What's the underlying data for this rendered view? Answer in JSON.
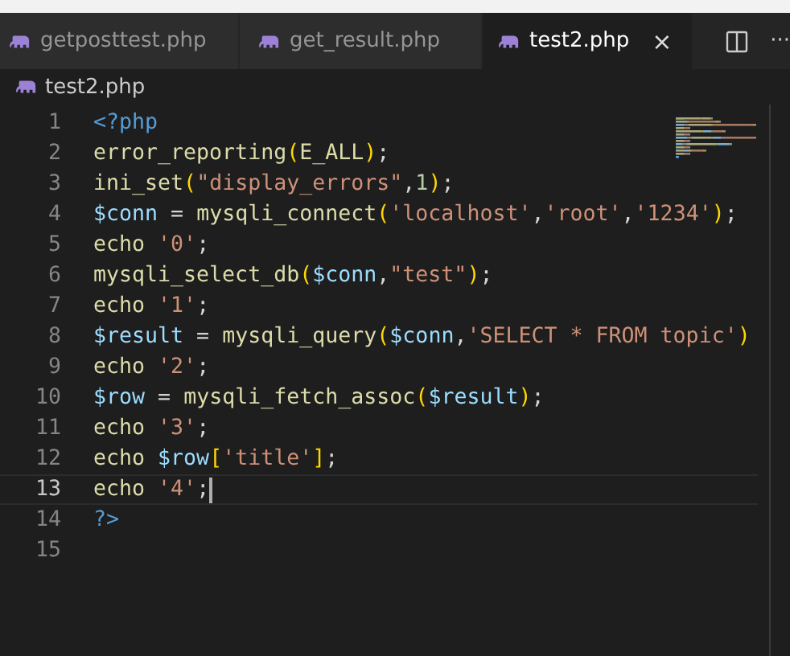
{
  "tabs": [
    {
      "label": "getposttest.php",
      "selected": false
    },
    {
      "label": "get_result.php",
      "selected": false
    },
    {
      "label": "test2.php",
      "selected": true,
      "close": "×"
    }
  ],
  "tab_actions": {
    "more": "···"
  },
  "breadcrumb": "test2.php",
  "lines": [
    {
      "number": "1",
      "current": false,
      "tokens": [
        {
          "kind": "tag",
          "text": "<?php"
        }
      ]
    },
    {
      "number": "2",
      "current": false,
      "tokens": [
        {
          "kind": "fn",
          "text": "error_reporting"
        },
        {
          "kind": "bracket",
          "text": "("
        },
        {
          "kind": "fn",
          "text": "E_ALL"
        },
        {
          "kind": "bracket",
          "text": ")"
        },
        {
          "kind": "plain",
          "text": ";"
        }
      ]
    },
    {
      "number": "3",
      "current": false,
      "tokens": [
        {
          "kind": "fn",
          "text": "ini_set"
        },
        {
          "kind": "bracket",
          "text": "("
        },
        {
          "kind": "str",
          "text": "\"display_errors\""
        },
        {
          "kind": "plain",
          "text": ","
        },
        {
          "kind": "num",
          "text": "1"
        },
        {
          "kind": "bracket",
          "text": ")"
        },
        {
          "kind": "plain",
          "text": ";"
        }
      ]
    },
    {
      "number": "4",
      "current": false,
      "tokens": [
        {
          "kind": "var",
          "text": "$conn"
        },
        {
          "kind": "plain",
          "text": " = "
        },
        {
          "kind": "fn",
          "text": "mysqli_connect"
        },
        {
          "kind": "bracket",
          "text": "("
        },
        {
          "kind": "str",
          "text": "'localhost'"
        },
        {
          "kind": "plain",
          "text": ","
        },
        {
          "kind": "str",
          "text": "'root'"
        },
        {
          "kind": "plain",
          "text": ","
        },
        {
          "kind": "str",
          "text": "'1234'"
        },
        {
          "kind": "bracket",
          "text": ")"
        },
        {
          "kind": "plain",
          "text": ";"
        }
      ]
    },
    {
      "number": "5",
      "current": false,
      "tokens": [
        {
          "kind": "fn",
          "text": "echo "
        },
        {
          "kind": "str",
          "text": "'0'"
        },
        {
          "kind": "plain",
          "text": ";"
        }
      ]
    },
    {
      "number": "6",
      "current": false,
      "tokens": [
        {
          "kind": "fn",
          "text": "mysqli_select_db"
        },
        {
          "kind": "bracket",
          "text": "("
        },
        {
          "kind": "var",
          "text": "$conn"
        },
        {
          "kind": "plain",
          "text": ","
        },
        {
          "kind": "str",
          "text": "\"test\""
        },
        {
          "kind": "bracket",
          "text": ")"
        },
        {
          "kind": "plain",
          "text": ";"
        }
      ]
    },
    {
      "number": "7",
      "current": false,
      "tokens": [
        {
          "kind": "fn",
          "text": "echo "
        },
        {
          "kind": "str",
          "text": "'1'"
        },
        {
          "kind": "plain",
          "text": ";"
        }
      ]
    },
    {
      "number": "8",
      "current": false,
      "tokens": [
        {
          "kind": "var",
          "text": "$result"
        },
        {
          "kind": "plain",
          "text": " = "
        },
        {
          "kind": "fn",
          "text": "mysqli_query"
        },
        {
          "kind": "bracket",
          "text": "("
        },
        {
          "kind": "var",
          "text": "$conn"
        },
        {
          "kind": "plain",
          "text": ","
        },
        {
          "kind": "str",
          "text": "'SELECT * FROM topic'"
        },
        {
          "kind": "bracket",
          "text": ")"
        }
      ]
    },
    {
      "number": "9",
      "current": false,
      "tokens": [
        {
          "kind": "fn",
          "text": "echo "
        },
        {
          "kind": "str",
          "text": "'2'"
        },
        {
          "kind": "plain",
          "text": ";"
        }
      ]
    },
    {
      "number": "10",
      "current": false,
      "tokens": [
        {
          "kind": "var",
          "text": "$row"
        },
        {
          "kind": "plain",
          "text": " = "
        },
        {
          "kind": "fn",
          "text": "mysqli_fetch_assoc"
        },
        {
          "kind": "bracket",
          "text": "("
        },
        {
          "kind": "var",
          "text": "$result"
        },
        {
          "kind": "bracket",
          "text": ")"
        },
        {
          "kind": "plain",
          "text": ";"
        }
      ]
    },
    {
      "number": "11",
      "current": false,
      "tokens": [
        {
          "kind": "fn",
          "text": "echo "
        },
        {
          "kind": "str",
          "text": "'3'"
        },
        {
          "kind": "plain",
          "text": ";"
        }
      ]
    },
    {
      "number": "12",
      "current": false,
      "tokens": [
        {
          "kind": "fn",
          "text": "echo "
        },
        {
          "kind": "var",
          "text": "$row"
        },
        {
          "kind": "bracket",
          "text": "["
        },
        {
          "kind": "str",
          "text": "'title'"
        },
        {
          "kind": "bracket",
          "text": "]"
        },
        {
          "kind": "plain",
          "text": ";"
        }
      ]
    },
    {
      "number": "13",
      "current": true,
      "tokens": [
        {
          "kind": "fn",
          "text": "echo "
        },
        {
          "kind": "str",
          "text": "'4'"
        },
        {
          "kind": "plain",
          "text": ";"
        }
      ]
    },
    {
      "number": "14",
      "current": false,
      "tokens": [
        {
          "kind": "tag",
          "text": "?>"
        }
      ]
    },
    {
      "number": "15",
      "current": false
    }
  ]
}
